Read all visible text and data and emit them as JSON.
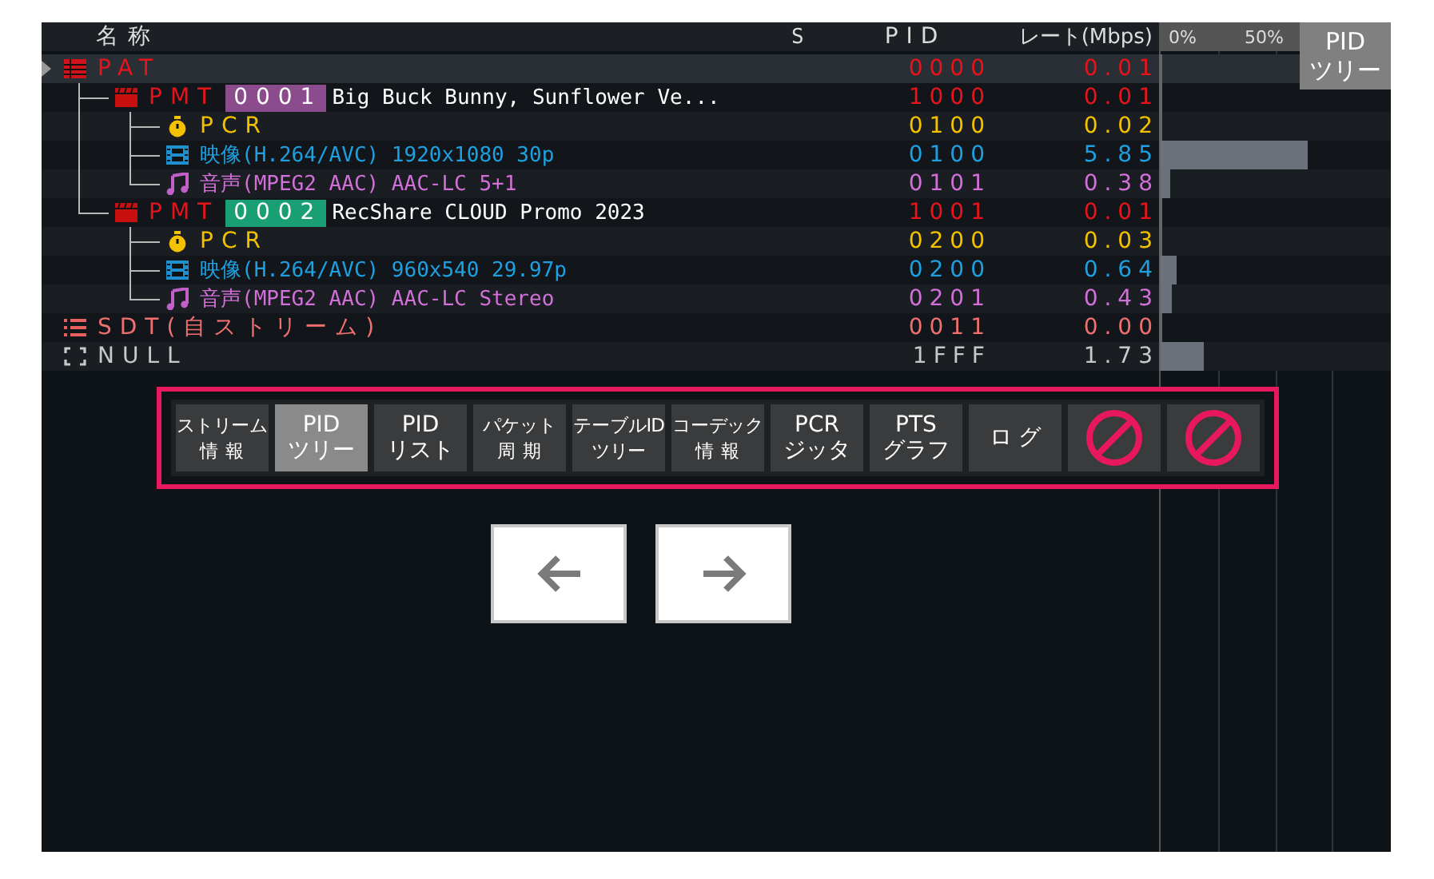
{
  "header": {
    "name": "名称",
    "status": "S",
    "pid": "PID",
    "rate": "レート(Mbps)",
    "scale_min": "0%",
    "scale_mid": "50%"
  },
  "view_badge": "PID\nツリー",
  "tree": [
    {
      "kind": "pat",
      "name": "PAT",
      "pid": "0000",
      "rate": "0.01",
      "level": 0,
      "selected": true,
      "children": [
        {
          "kind": "pmt",
          "name": "PMT",
          "program": "0001",
          "color": "#8a4c8c",
          "service": "Big Buck Bunny, Sunflower Ve...",
          "pid": "1000",
          "rate": "0.01",
          "level": 0,
          "selected": false,
          "children": [
            {
              "kind": "pcr",
              "name": "PCR",
              "pid": "0100",
              "rate": "0.02",
              "level": 0,
              "selected": false
            },
            {
              "kind": "video",
              "name": "映像(H.264/AVC) 1920x1080 30p",
              "pid": "0100",
              "rate": "5.85",
              "level": 0.64,
              "selected": false
            },
            {
              "kind": "audio",
              "name": "音声(MPEG2 AAC) AAC-LC 5+1",
              "pid": "0101",
              "rate": "0.38",
              "level": 0.04,
              "selected": false
            }
          ]
        },
        {
          "kind": "pmt",
          "name": "PMT",
          "program": "0002",
          "color": "#1a9e74",
          "service": "RecShare CLOUD Promo 2023",
          "pid": "1001",
          "rate": "0.01",
          "level": 0,
          "selected": false,
          "children": [
            {
              "kind": "pcr",
              "name": "PCR",
              "pid": "0200",
              "rate": "0.03",
              "level": 0,
              "selected": false
            },
            {
              "kind": "video",
              "name": "映像(H.264/AVC) 960x540 29.97p",
              "pid": "0200",
              "rate": "0.64",
              "level": 0.07,
              "selected": false
            },
            {
              "kind": "audio",
              "name": "音声(MPEG2 AAC) AAC-LC Stereo",
              "pid": "0201",
              "rate": "0.43",
              "level": 0.05,
              "selected": false
            }
          ]
        }
      ]
    },
    {
      "kind": "sdt",
      "name": "SDT(自ストリーム)",
      "pid": "0011",
      "rate": "0.00",
      "level": 0,
      "selected": false
    },
    {
      "kind": "null",
      "name": "NULL",
      "pid": "1FFF",
      "rate": "1.73",
      "level": 0.19,
      "selected": false
    }
  ],
  "toolbar": [
    {
      "lines": [
        "ストリーム",
        "情報"
      ],
      "selected": false,
      "disabled": false
    },
    {
      "lines": [
        "PID",
        "ツリー"
      ],
      "selected": true,
      "disabled": false
    },
    {
      "lines": [
        "PID",
        "リスト"
      ],
      "selected": false,
      "disabled": false
    },
    {
      "lines": [
        "パケット",
        "周期"
      ],
      "selected": false,
      "disabled": false
    },
    {
      "lines": [
        "テーブルID",
        "ツリー"
      ],
      "selected": false,
      "disabled": false
    },
    {
      "lines": [
        "コーデック",
        "情報"
      ],
      "selected": false,
      "disabled": false
    },
    {
      "lines": [
        "PCR",
        "ジッタ"
      ],
      "selected": false,
      "disabled": false
    },
    {
      "lines": [
        "PTS",
        "グラフ"
      ],
      "selected": false,
      "disabled": false
    },
    {
      "lines": [
        "ログ"
      ],
      "selected": false,
      "disabled": false
    },
    {
      "selected": false,
      "disabled": true
    },
    {
      "selected": false,
      "disabled": true
    }
  ]
}
